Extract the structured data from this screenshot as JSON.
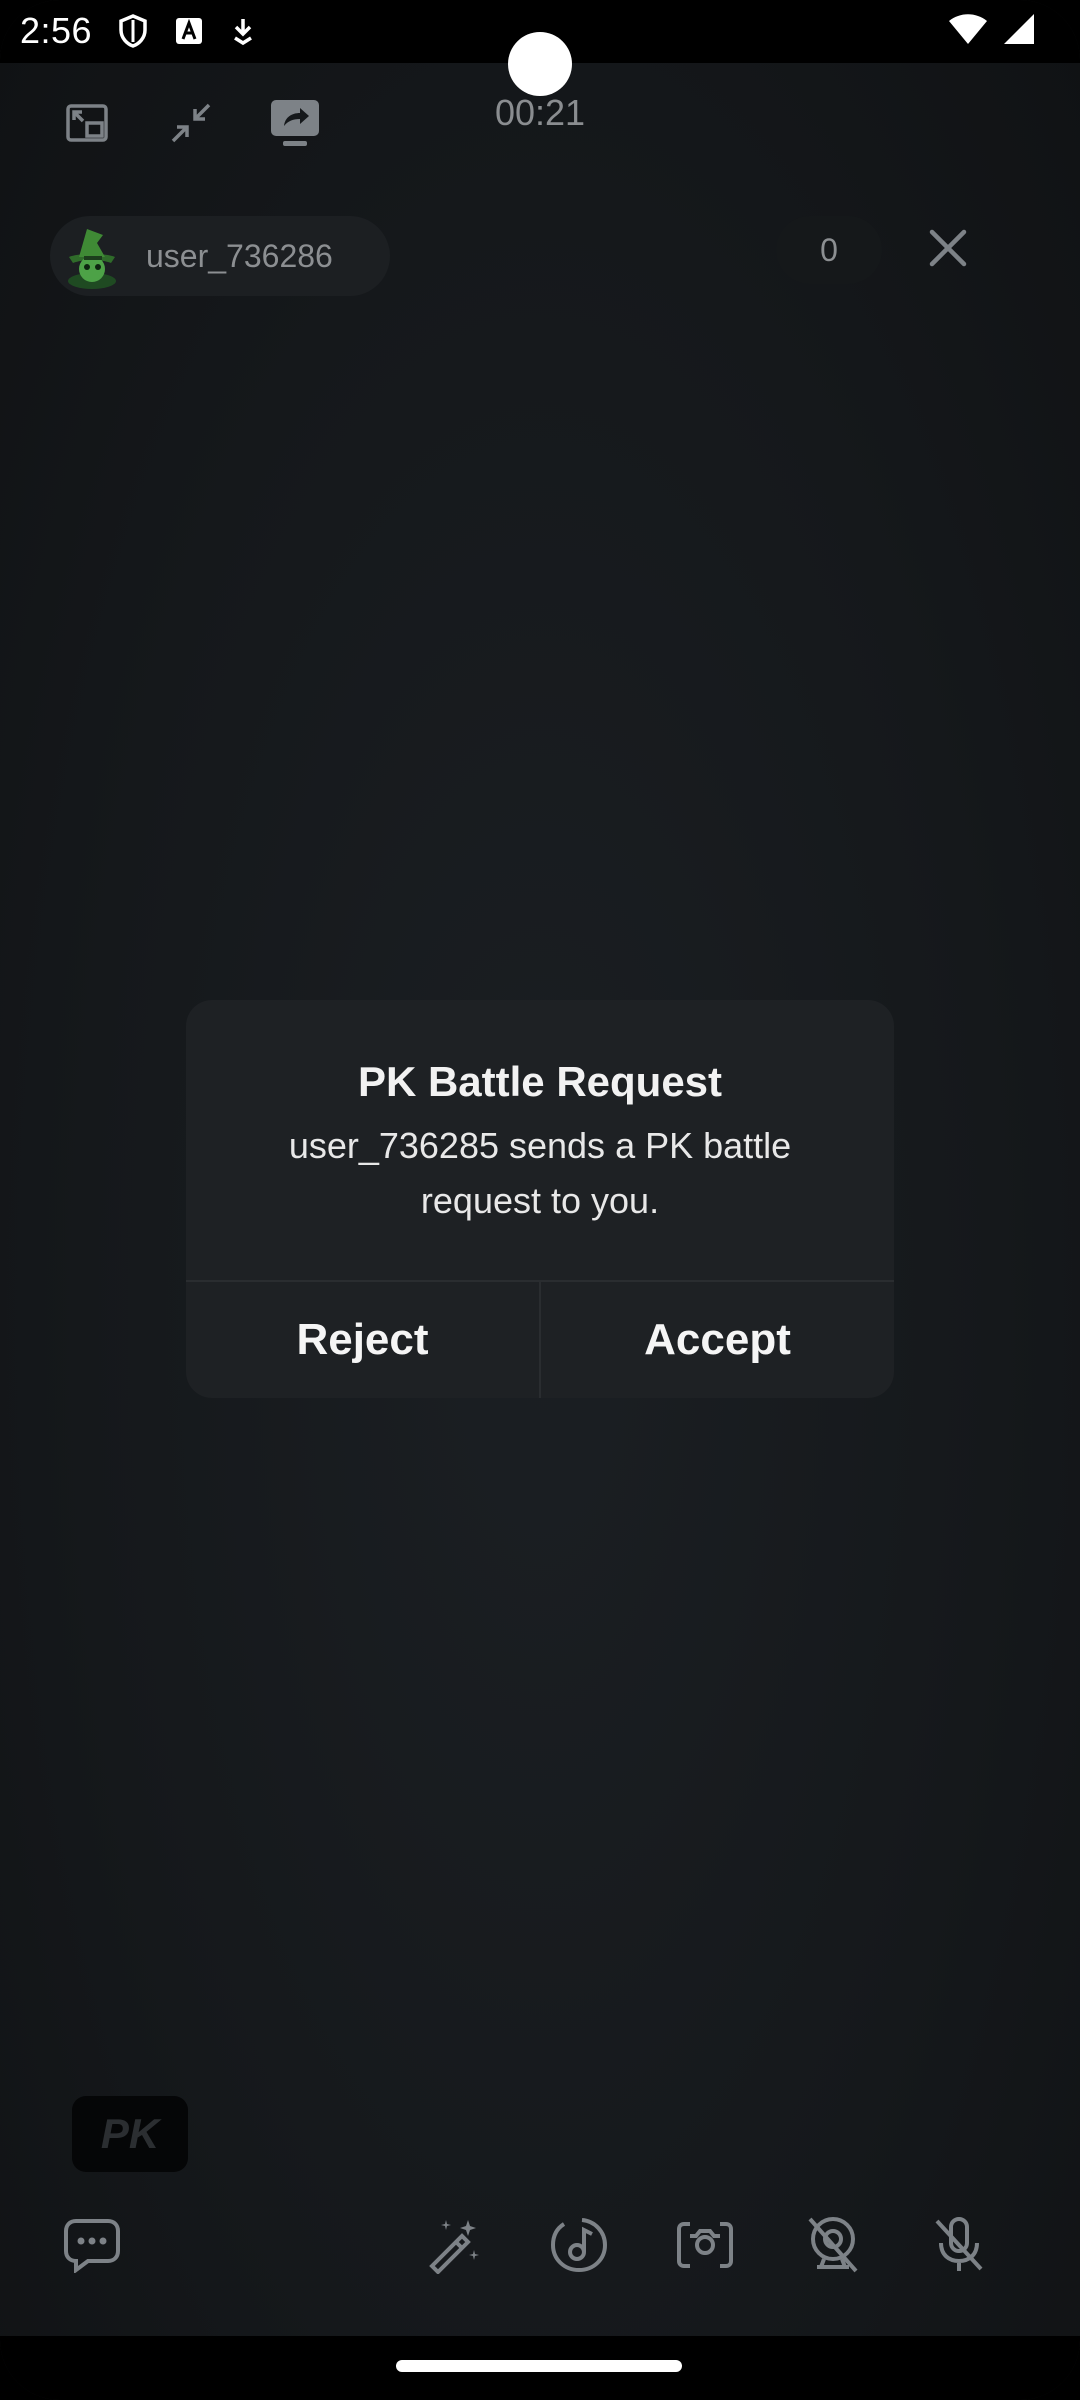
{
  "status_bar": {
    "time": "2:56"
  },
  "call": {
    "timer": "00:21"
  },
  "remote_user": {
    "name": "user_736286",
    "score": "0"
  },
  "dialog": {
    "title": "PK Battle Request",
    "message": "user_736285 sends a PK battle request to you.",
    "reject_label": "Reject",
    "accept_label": "Accept"
  },
  "pk_badge": {
    "label": "PK"
  },
  "colors": {
    "background": "#15181b",
    "dialog": "#1e2124",
    "icon": "#7d8287"
  }
}
